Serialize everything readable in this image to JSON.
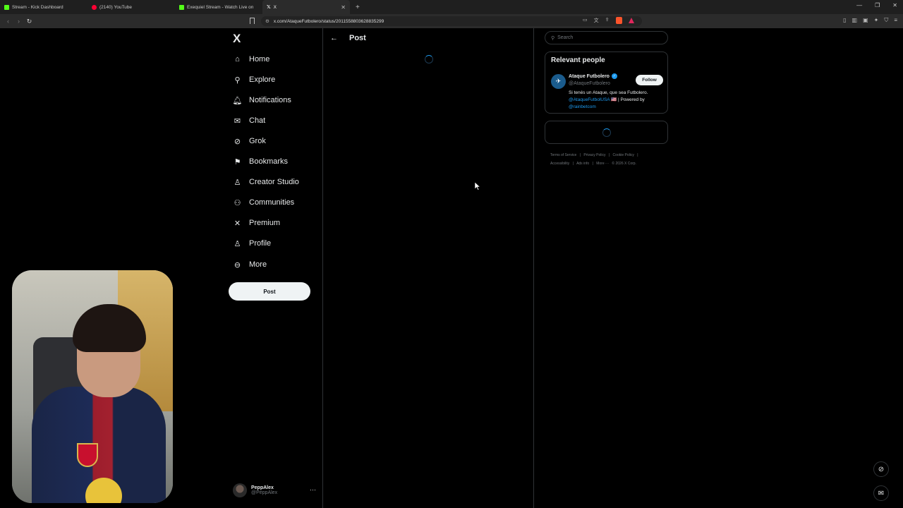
{
  "browser": {
    "tabs": [
      {
        "label": "Stream - Kick Dashboard",
        "favicon_color": "#53fc18"
      },
      {
        "label": "(2140) YouTube",
        "favicon_color": "#ff0033"
      },
      {
        "label": "Exequiel Stream - Watch Live on",
        "favicon_color": "#53fc18"
      },
      {
        "label": "X",
        "favicon_color": "#ffffff",
        "active": true
      }
    ],
    "url": "x.com/AtaqueFutbolero/status/2011558803628835299"
  },
  "sidebar": {
    "logo": "X",
    "items": [
      {
        "label": "Home",
        "icon": "home-icon",
        "glyph": "⌂"
      },
      {
        "label": "Explore",
        "icon": "search-icon",
        "glyph": "⚲"
      },
      {
        "label": "Notifications",
        "icon": "bell-icon",
        "glyph": "🔔︎"
      },
      {
        "label": "Chat",
        "icon": "mail-icon",
        "glyph": "✉"
      },
      {
        "label": "Grok",
        "icon": "grok-icon",
        "glyph": "⊘"
      },
      {
        "label": "Bookmarks",
        "icon": "bookmark-icon",
        "glyph": "⚑"
      },
      {
        "label": "Creator Studio",
        "icon": "creator-icon",
        "glyph": "♙"
      },
      {
        "label": "Communities",
        "icon": "communities-icon",
        "glyph": "⚇"
      },
      {
        "label": "Premium",
        "icon": "x-premium-icon",
        "glyph": "✕"
      },
      {
        "label": "Profile",
        "icon": "profile-icon",
        "glyph": "♙"
      },
      {
        "label": "More",
        "icon": "more-icon",
        "glyph": "⊖"
      }
    ],
    "post_button": "Post",
    "account": {
      "name": "PeppAlex",
      "handle": "@PeppAlex"
    }
  },
  "main": {
    "title": "Post"
  },
  "right": {
    "search_placeholder": "Search",
    "relevant_title": "Relevant people",
    "person": {
      "name": "Ataque Futbolero",
      "handle": "@AtaqueFutbolero",
      "follow": "Follow",
      "bio_text": "Si tenés un Ataque, que sea Futbolero.",
      "bio_link1": "@AtaqueFutbolUSA",
      "bio_mid": " 🇺🇸 | Powered by",
      "bio_link2": "@rainbetcom"
    },
    "footer": [
      "Terms of Service",
      "|",
      "Privacy Policy",
      "|",
      "Cookie Policy",
      "|",
      "Accessibility",
      "|",
      "Ads info",
      "|",
      "More ···",
      "© 2026 X Corp."
    ]
  },
  "colors": {
    "accent": "#1d9bf0",
    "border": "#2f3336",
    "muted": "#71767b"
  }
}
